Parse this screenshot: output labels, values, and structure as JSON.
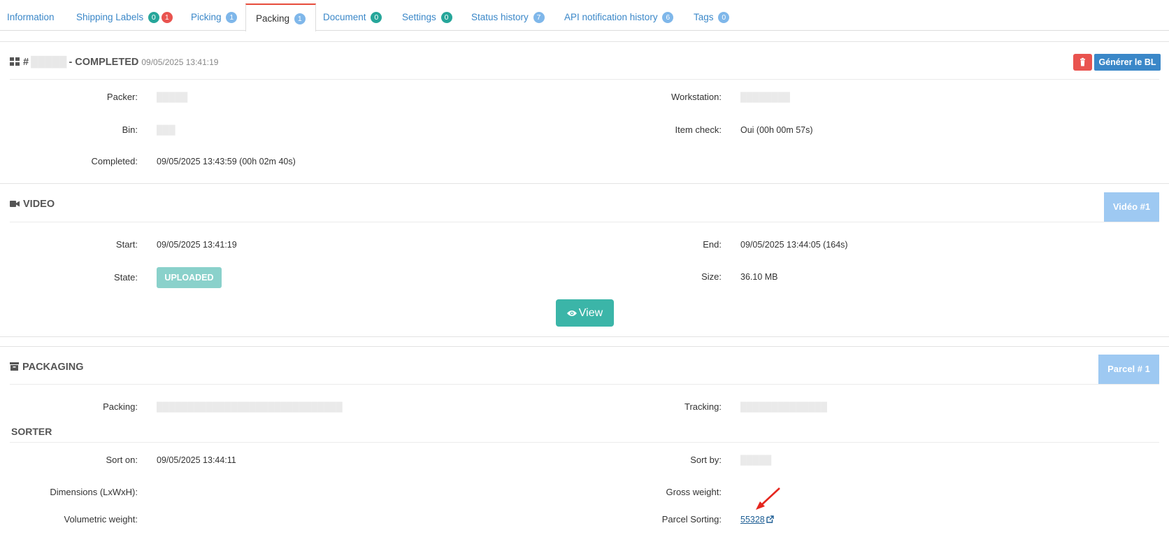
{
  "tabs": [
    {
      "label": "Information",
      "badges": []
    },
    {
      "label": "Shipping Labels",
      "badges": [
        {
          "value": "0",
          "color": "#26a69a"
        },
        {
          "value": "1",
          "color": "#e9534f"
        }
      ]
    },
    {
      "label": "Picking",
      "badges": [
        {
          "value": "1",
          "color": "#7fb7ea"
        }
      ]
    },
    {
      "label": "Packing",
      "badges": [
        {
          "value": "1",
          "color": "#7fb7ea"
        }
      ]
    },
    {
      "label": "Document",
      "badges": [
        {
          "value": "0",
          "color": "#26a69a"
        }
      ]
    },
    {
      "label": "Settings",
      "badges": [
        {
          "value": "0",
          "color": "#26a69a"
        }
      ]
    },
    {
      "label": "Status history",
      "badges": [
        {
          "value": "7",
          "color": "#7fb7ea"
        }
      ]
    },
    {
      "label": "API notification history",
      "badges": [
        {
          "value": "6",
          "color": "#7fb7ea"
        }
      ]
    },
    {
      "label": "Tags",
      "badges": [
        {
          "value": "0",
          "color": "#7fb7ea"
        }
      ]
    }
  ],
  "active_tab": "Packing",
  "packing": {
    "hash": "#",
    "status": "- COMPLETED",
    "timestamp": "09/05/2025 13:41:19",
    "generate_button": "Générer le BL",
    "fields": {
      "packer_label": "Packer:",
      "workstation_label": "Workstation:",
      "bin_label": "Bin:",
      "item_check_label": "Item check:",
      "item_check_value": "Oui (00h 00m 57s)",
      "completed_label": "Completed:",
      "completed_value": "09/05/2025 13:43:59 (00h 02m 40s)"
    }
  },
  "video": {
    "title": "VIDEO",
    "video_button": "Vidéo #1",
    "start_label": "Start:",
    "start_value": "09/05/2025 13:41:19",
    "end_label": "End:",
    "end_value": "09/05/2025 13:44:05 (164s)",
    "state_label": "State:",
    "state_value": "UPLOADED",
    "size_label": "Size:",
    "size_value": "36.10 MB",
    "view_button": "View"
  },
  "packaging": {
    "title": "PACKAGING",
    "parcel_button": "Parcel # 1",
    "packing_label": "Packing:",
    "tracking_label": "Tracking:"
  },
  "sorter": {
    "title": "SORTER",
    "sort_on_label": "Sort on:",
    "sort_on_value": "09/05/2025 13:44:11",
    "sort_by_label": "Sort by:",
    "dimensions_label": "Dimensions (LxWxH):",
    "gross_weight_label": "Gross weight:",
    "volumetric_label": "Volumetric weight:",
    "parcel_sorting_label": "Parcel Sorting:",
    "parcel_sorting_value": "55328"
  },
  "colors": {
    "accent": "#3a87c8",
    "danger": "#e9534f",
    "teal": "#3bb5a8",
    "active_tab_border": "#e74c3c"
  }
}
